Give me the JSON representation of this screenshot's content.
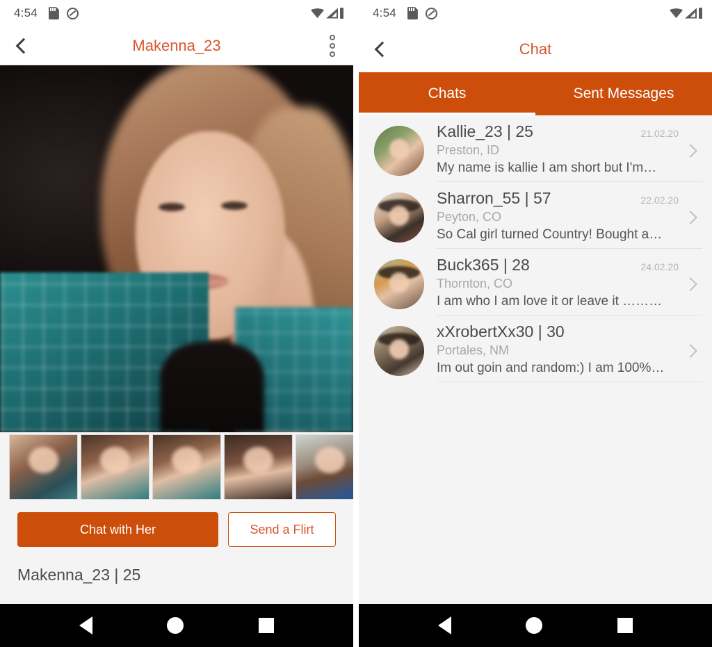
{
  "profile_screen": {
    "status_bar": {
      "time": "4:54",
      "icons": [
        "sd-card-icon",
        "do-not-disturb-icon",
        "wifi-icon",
        "cell-signal-icon",
        "battery-icon"
      ]
    },
    "app_bar": {
      "back": "back-arrow-icon",
      "title": "Makenna_23",
      "overflow": "overflow-menu-icon"
    },
    "hero_photo_alt": "Makenna_23 profile photo",
    "thumbnails": [
      {
        "label": "photo-1"
      },
      {
        "label": "photo-2"
      },
      {
        "label": "photo-3"
      },
      {
        "label": "photo-4"
      },
      {
        "label": "photo-5"
      }
    ],
    "actions": {
      "chat_label": "Chat with Her",
      "flirt_label": "Send a Flirt"
    },
    "name_line": "Makenna_23 | 25",
    "name_sub": ""
  },
  "chat_screen": {
    "status_bar": {
      "time": "4:54",
      "icons": [
        "sd-card-icon",
        "do-not-disturb-icon",
        "wifi-icon",
        "cell-signal-icon",
        "battery-icon"
      ]
    },
    "app_bar": {
      "back": "back-arrow-icon",
      "title": "Chat"
    },
    "tabs": [
      {
        "label": "Chats",
        "active": true
      },
      {
        "label": "Sent Messages",
        "active": false
      }
    ],
    "conversations": [
      {
        "name": "Kallie_23 | 25",
        "location": "Preston, ID",
        "preview": "My name is kallie I am short but I'm…",
        "date": "21.02.20"
      },
      {
        "name": "Sharron_55 | 57",
        "location": "Peyton, CO",
        "preview": "So Cal girl turned Country! Bought a…",
        "date": "22.02.20"
      },
      {
        "name": "Buck365 | 28",
        "location": "Thornton, CO",
        "preview": "I am who I am love it or leave it ………",
        "date": "24.02.20"
      },
      {
        "name": "xXrobertXx30 | 30",
        "location": "Portales, NM",
        "preview": "Im out goin and random:) I am 100%…",
        "date": ""
      }
    ]
  },
  "nav_bar": {
    "back": "nav-back-icon",
    "home": "nav-home-icon",
    "recents": "nav-recents-icon"
  },
  "colors": {
    "accent_orange": "#cc4e0a",
    "title_orange": "#d9552c",
    "page_bg": "#f4f4f4",
    "text_primary": "#4a4a4a",
    "text_secondary": "#a8a8a8"
  }
}
